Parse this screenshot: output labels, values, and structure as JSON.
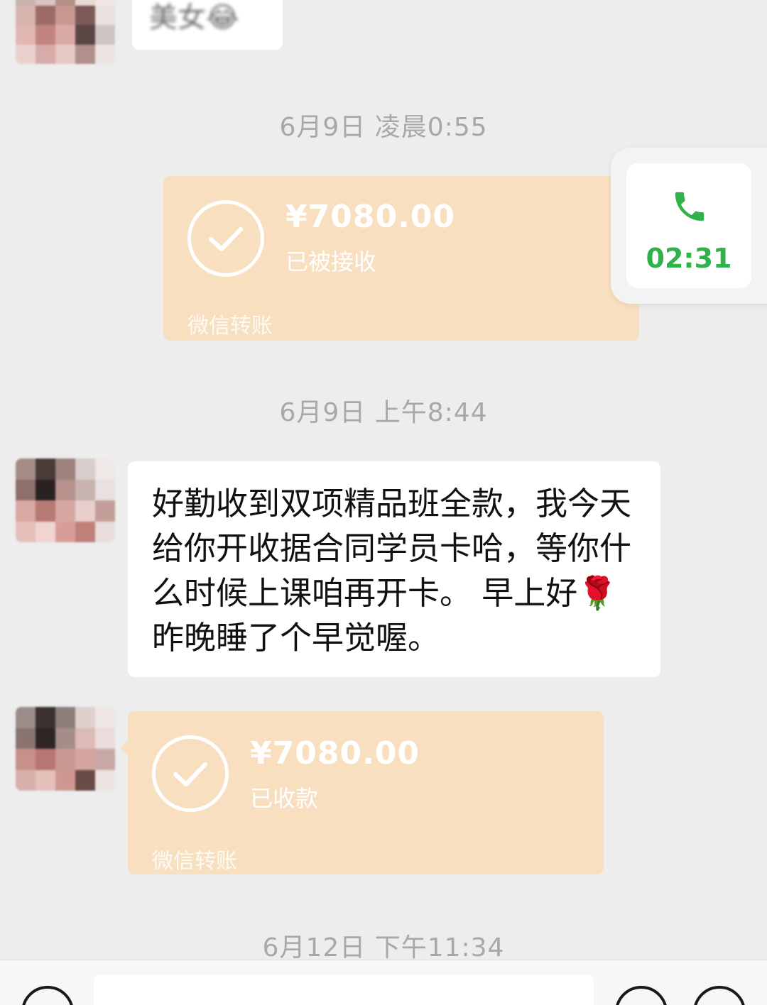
{
  "conversation": [
    {
      "type": "text",
      "side": "left",
      "text": "美女😂"
    },
    {
      "type": "timestamp",
      "text": "6月9日 凌晨0:55"
    },
    {
      "type": "transfer",
      "side": "right",
      "amount": "¥7080.00",
      "status": "已被接收",
      "label": "微信转账"
    },
    {
      "type": "timestamp",
      "text": "6月9日 上午8:44"
    },
    {
      "type": "text",
      "side": "left",
      "text": "好勤收到双项精品班全款，我今天给你开收据合同学员卡哈，等你什么时候上课咱再开卡。 早上好🌹昨晚睡了个早觉喔。"
    },
    {
      "type": "transfer",
      "side": "left",
      "amount": "¥7080.00",
      "status": "已收款",
      "label": "微信转账"
    },
    {
      "type": "timestamp",
      "text": "6月12日 下午11:34"
    }
  ],
  "call_float": {
    "duration": "02:31",
    "icon": "phone-icon",
    "color": "#2fb24a"
  },
  "input_bar": {
    "voice_icon": "voice-icon",
    "emoji_icon": "emoji-icon",
    "add_icon": "plus-icon"
  },
  "colors": {
    "background": "#ededed",
    "transfer_bubble": "#f8dfc0",
    "call_green": "#2fb24a"
  }
}
